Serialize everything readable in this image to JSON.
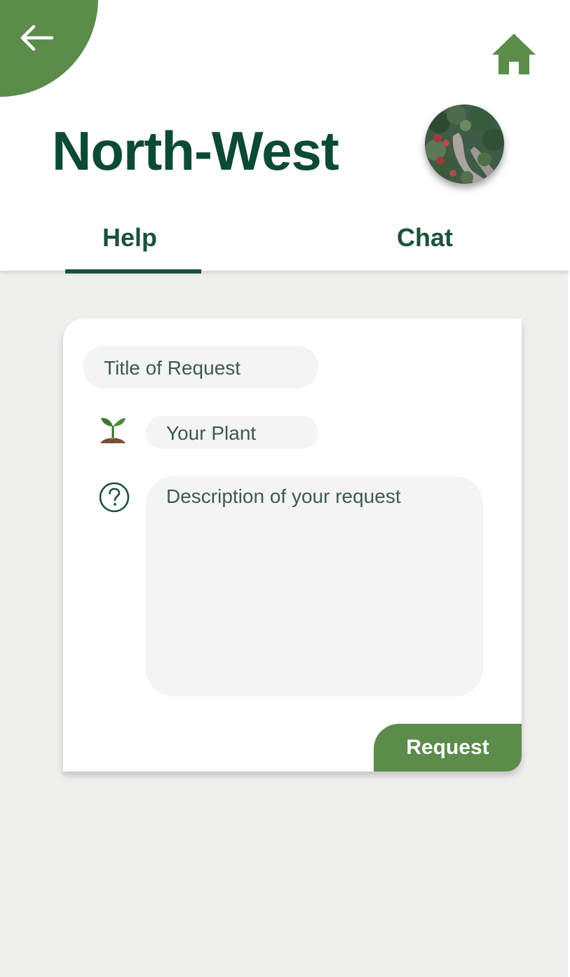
{
  "header": {
    "title": "North-West",
    "back_icon": "arrow-left-icon",
    "home_icon": "home-icon"
  },
  "tabs": [
    {
      "label": "Help",
      "active": true
    },
    {
      "label": "Chat",
      "active": false
    }
  ],
  "form": {
    "title_placeholder": "Title of Request",
    "plant_placeholder": "Your Plant",
    "description_placeholder": "Description of your request",
    "plant_icon": "sprout-icon",
    "description_icon": "question-circle-icon",
    "submit_label": "Request"
  },
  "colors": {
    "brand_green": "#5b8c4a",
    "dark_green": "#0d4a32",
    "background": "#efefee"
  }
}
